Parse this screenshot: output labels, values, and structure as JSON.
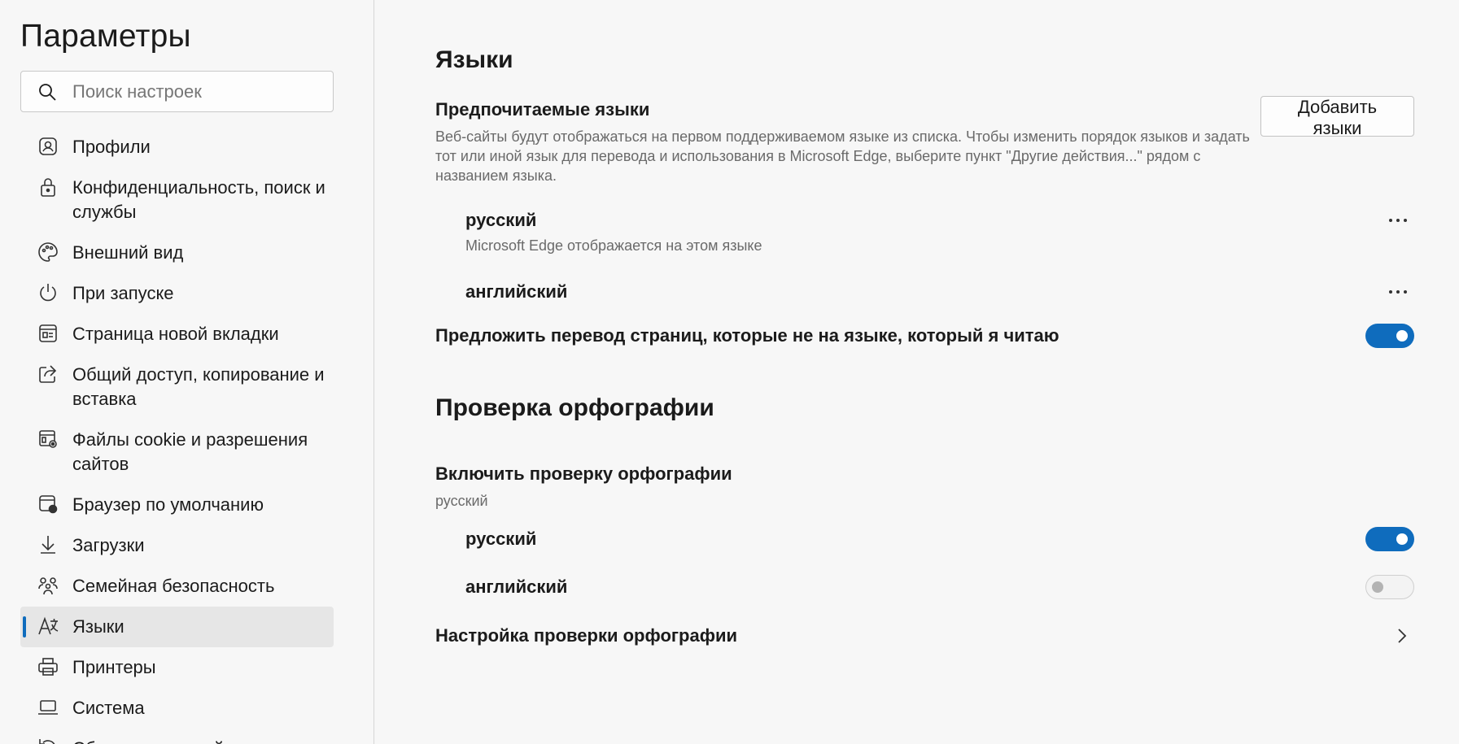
{
  "sidebar": {
    "title": "Параметры",
    "search_placeholder": "Поиск настроек",
    "items": [
      {
        "label": "Профили",
        "icon": "profile-icon"
      },
      {
        "label": "Конфиденциальность, поиск и службы",
        "icon": "lock-icon"
      },
      {
        "label": "Внешний вид",
        "icon": "palette-icon"
      },
      {
        "label": "При запуске",
        "icon": "power-icon"
      },
      {
        "label": "Страница новой вкладки",
        "icon": "new-tab-icon"
      },
      {
        "label": "Общий доступ, копирование и вставка",
        "icon": "share-icon"
      },
      {
        "label": "Файлы cookie и разрешения сайтов",
        "icon": "cookie-settings-icon"
      },
      {
        "label": "Браузер по умолчанию",
        "icon": "default-browser-icon"
      },
      {
        "label": "Загрузки",
        "icon": "download-icon"
      },
      {
        "label": "Семейная безопасность",
        "icon": "family-icon"
      },
      {
        "label": "Языки",
        "icon": "languages-icon",
        "active": true
      },
      {
        "label": "Принтеры",
        "icon": "printer-icon"
      },
      {
        "label": "Система",
        "icon": "laptop-icon"
      },
      {
        "label": "Сбросить настройки",
        "icon": "reset-icon"
      }
    ]
  },
  "languages": {
    "heading": "Языки",
    "preferred_title": "Предпочитаемые языки",
    "preferred_desc": "Веб-сайты будут отображаться на первом поддерживаемом языке из списка. Чтобы изменить порядок языков и задать тот или иной язык для перевода и использования в Microsoft Edge, выберите пункт \"Другие действия...\" рядом с названием языка.",
    "add_button": "Добавить языки",
    "list": [
      {
        "name": "русский",
        "sub": "Microsoft Edge отображается на этом языке"
      },
      {
        "name": "английский",
        "sub": ""
      }
    ],
    "translate_offer": "Предложить перевод страниц, которые не на языке, который я читаю",
    "translate_offer_on": true
  },
  "spellcheck": {
    "heading": "Проверка орфографии",
    "enable_title": "Включить проверку орфографии",
    "enable_sub": "русский",
    "languages": [
      {
        "name": "русский",
        "on": true
      },
      {
        "name": "английский",
        "on": false
      }
    ],
    "customize_label": "Настройка проверки орфографии"
  },
  "colors": {
    "accent": "#0f6cbd"
  }
}
